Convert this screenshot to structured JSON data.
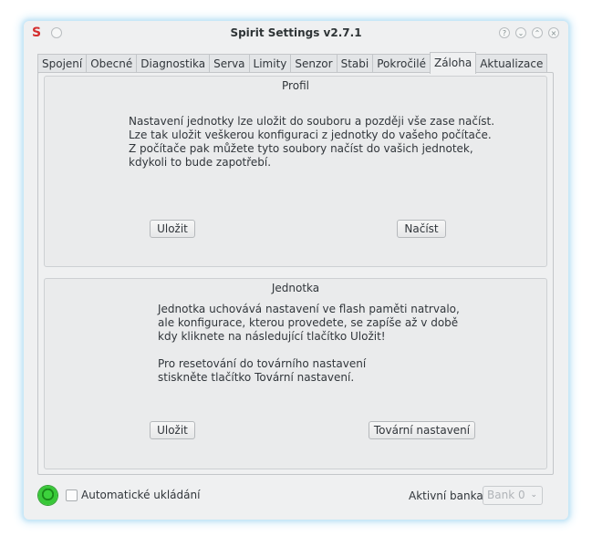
{
  "window": {
    "title": "Spirit Settings v2.7.1",
    "app_icon": "S",
    "buttons": [
      {
        "name": "help-icon",
        "glyph": "?"
      },
      {
        "name": "minimize-icon",
        "glyph": "⌄"
      },
      {
        "name": "maximize-icon",
        "glyph": "⌃"
      },
      {
        "name": "close-icon",
        "glyph": "×"
      }
    ]
  },
  "tabs": [
    {
      "label": "Spojení"
    },
    {
      "label": "Obecné"
    },
    {
      "label": "Diagnostika"
    },
    {
      "label": "Serva"
    },
    {
      "label": "Limity"
    },
    {
      "label": "Senzor"
    },
    {
      "label": "Stabi"
    },
    {
      "label": "Pokročilé"
    },
    {
      "label": "Záloha",
      "active": true
    },
    {
      "label": "Aktualizace"
    }
  ],
  "profile": {
    "title": "Profil",
    "description": "Nastavení jednotky lze uložit do souboru a později vše zase načíst.\nLze tak uložit veškerou konfiguraci z jednotky do vašeho počítače.\nZ počítače pak můžete tyto soubory načíst do vašich jednotek,\nkdykoli to bude zapotřebí.",
    "save_label": "Uložit",
    "load_label": "Načíst"
  },
  "unit": {
    "title": "Jednotka",
    "description": "Jednotka uchovává nastavení ve flash paměti natrvalo,\nale konfigurace, kterou provedete, se zapíše až v době\nkdy kliknete na následující tlačítko Uložit!\n\nPro resetování do továrního nastavení\nstiskněte tlačítko Tovární nastavení.",
    "save_label": "Uložit",
    "factory_label": "Tovární nastavení"
  },
  "footer": {
    "autosave_label": "Automatické ukládání",
    "autosave_checked": false,
    "bank_label": "Aktivní banka:",
    "bank_value": "Bank 0",
    "status_color": "#2fb52f"
  }
}
